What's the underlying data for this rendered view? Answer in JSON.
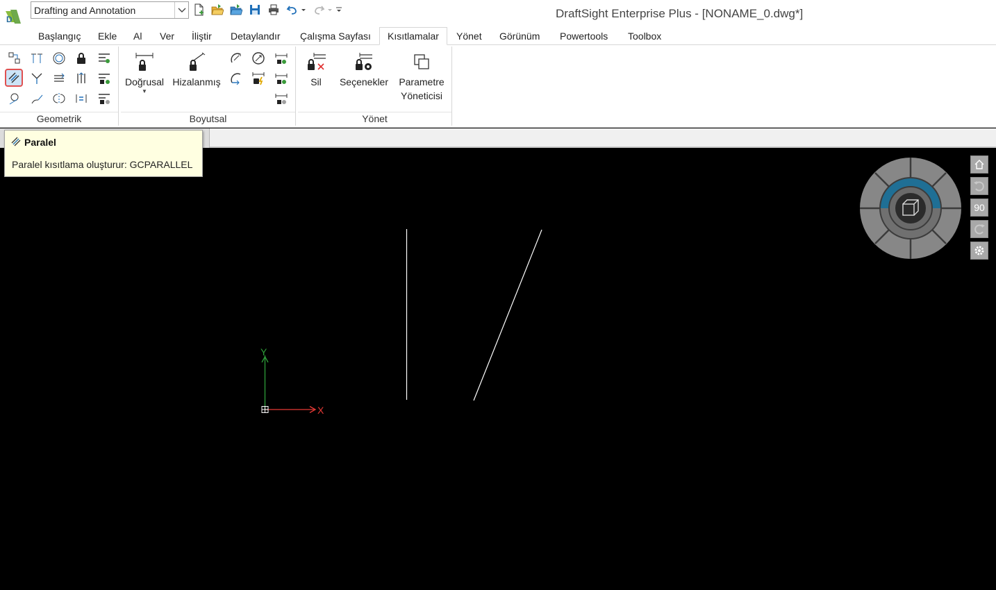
{
  "window": {
    "title": "DraftSight Enterprise Plus - [NONAME_0.dwg*]"
  },
  "workspace": {
    "selected": "Drafting and Annotation"
  },
  "quick_access": {
    "icons": [
      "new-file-icon",
      "open-file-icon",
      "open-folder-icon",
      "save-icon",
      "print-icon",
      "undo-icon",
      "redo-icon",
      "customize-icon"
    ]
  },
  "ribbon_tabs": [
    {
      "label": "Başlangıç"
    },
    {
      "label": "Ekle"
    },
    {
      "label": "Al"
    },
    {
      "label": "Ver"
    },
    {
      "label": "İliştir"
    },
    {
      "label": "Detaylandır"
    },
    {
      "label": "Çalışma Sayfası"
    },
    {
      "label": "Kısıtlamalar",
      "active": true
    },
    {
      "label": "Yönet"
    },
    {
      "label": "Görünüm"
    },
    {
      "label": "Powertools"
    },
    {
      "label": "Toolbox"
    }
  ],
  "panels": {
    "geometric": {
      "title": "Geometrik"
    },
    "dimensional": {
      "title": "Boyutsal",
      "linear_label": "Doğrusal",
      "aligned_label": "Hizalanmış"
    },
    "manage": {
      "title": "Yönet",
      "delete_label": "Sil",
      "options_label": "Seçenekler",
      "param_manager_line1": "Parametre",
      "param_manager_line2": "Yöneticisi"
    }
  },
  "tooltip": {
    "title": "Paralel",
    "description": "Paralel kısıtlama oluşturur: GCPARALLEL"
  },
  "canvas": {
    "ucs_x_label": "X",
    "ucs_y_label": "Y"
  },
  "navigation": {
    "rotate_label": "90"
  },
  "colors": {
    "canvas_bg": "#000000",
    "axis_x": "#e53935",
    "axis_y": "#2e9e3a",
    "highlight_border": "#e05050",
    "wheel_accent": "#1f6f95"
  }
}
